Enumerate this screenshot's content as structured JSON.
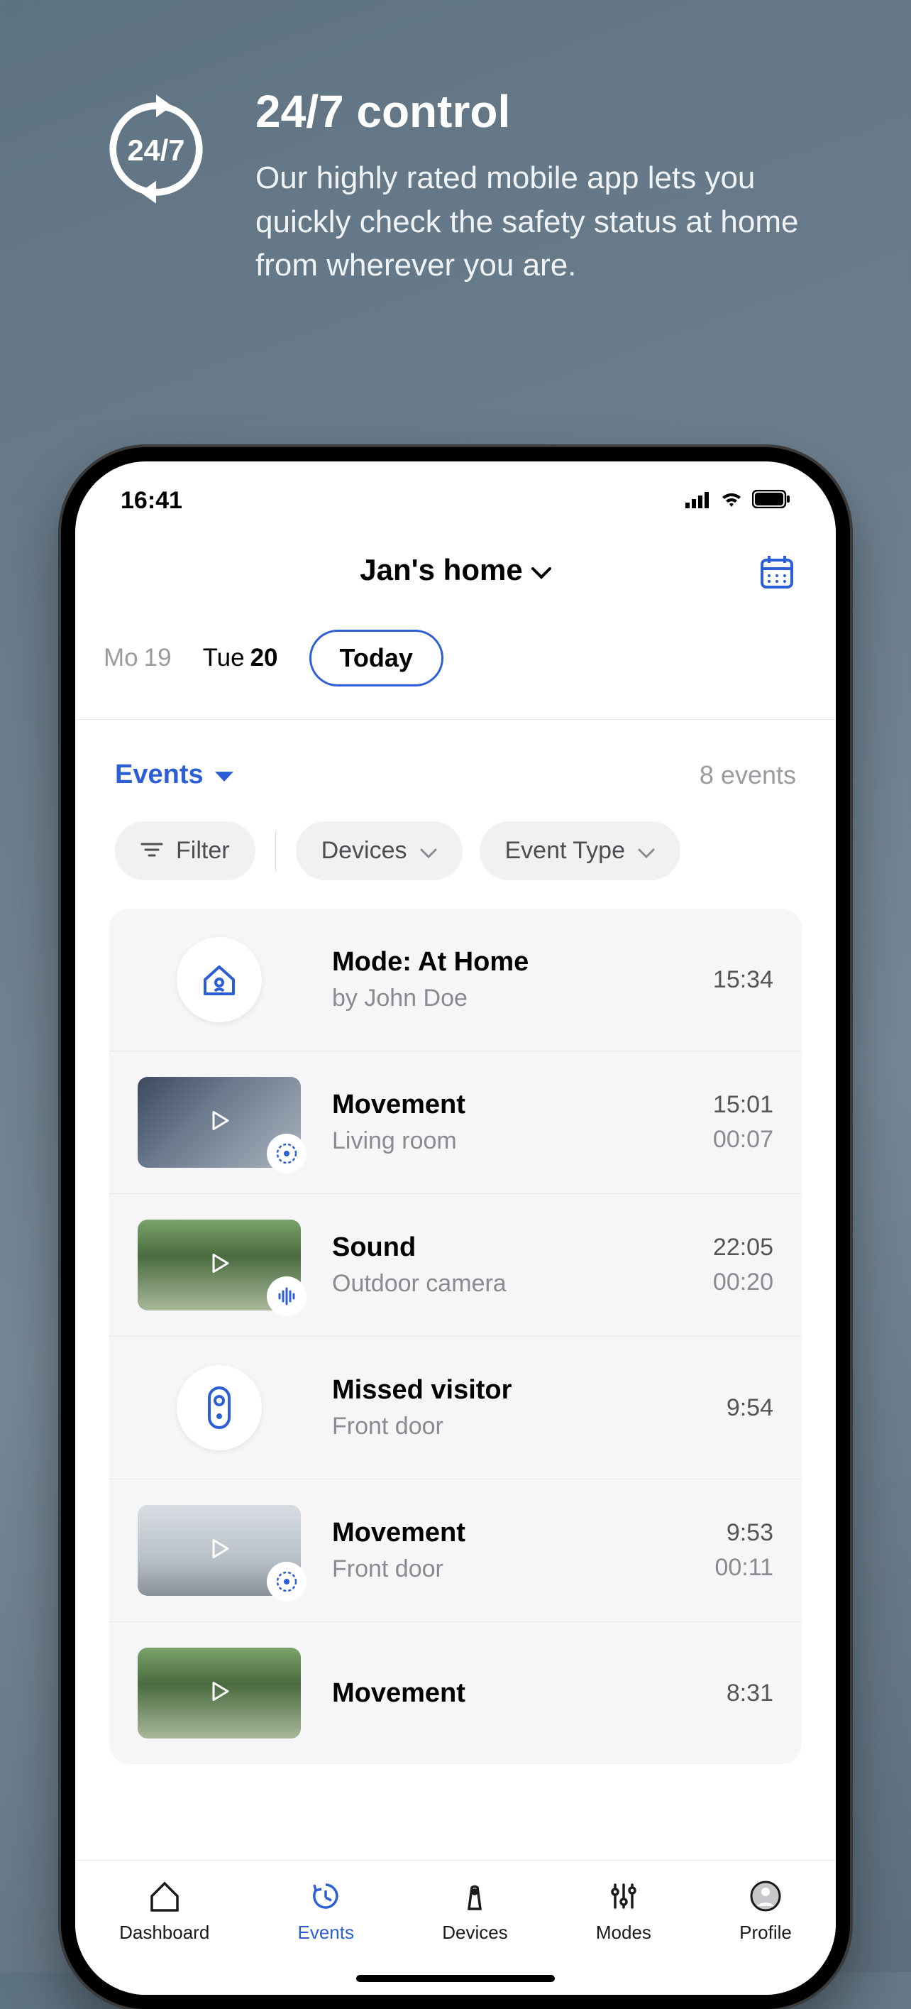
{
  "promo": {
    "icon_text": "24/7",
    "title": "24/7 control",
    "body": "Our highly rated mobile app lets you quickly check the safety status at home from wherever you are."
  },
  "statusbar": {
    "time": "16:41"
  },
  "header": {
    "home_name": "Jan's home"
  },
  "dates": {
    "d0_dow": "Mo",
    "d0_num": "19",
    "d1_dow": "Tue",
    "d1_num": "20",
    "today": "Today"
  },
  "section": {
    "events_label": "Events",
    "count_label": "8 events"
  },
  "chips": {
    "filter": "Filter",
    "devices": "Devices",
    "event_type": "Event Type"
  },
  "events": [
    {
      "title": "Mode: At Home",
      "sub": "by John Doe",
      "time": "15:34",
      "dur": ""
    },
    {
      "title": "Movement",
      "sub": "Living room",
      "time": "15:01",
      "dur": "00:07"
    },
    {
      "title": "Sound",
      "sub": "Outdoor camera",
      "time": "22:05",
      "dur": "00:20"
    },
    {
      "title": "Missed visitor",
      "sub": "Front door",
      "time": "9:54",
      "dur": ""
    },
    {
      "title": "Movement",
      "sub": "Front door",
      "time": "9:53",
      "dur": "00:11"
    },
    {
      "title": "Movement",
      "sub": "",
      "time": "8:31",
      "dur": ""
    }
  ],
  "tabs": {
    "dashboard": "Dashboard",
    "events": "Events",
    "devices": "Devices",
    "modes": "Modes",
    "profile": "Profile"
  }
}
